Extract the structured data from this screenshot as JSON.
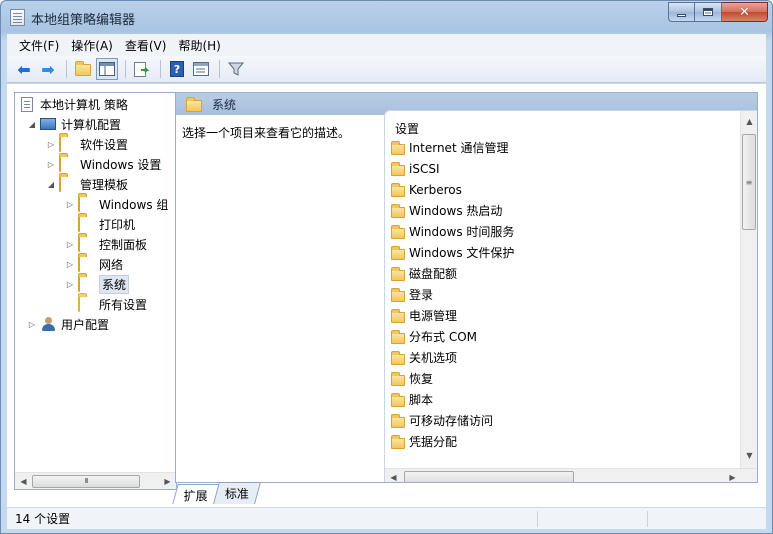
{
  "window": {
    "title": "本地组策略编辑器"
  },
  "menu": [
    "文件(F)",
    "操作(A)",
    "查看(V)",
    "帮助(H)"
  ],
  "tree": {
    "root": "本地计算机 策略",
    "computer_config": "计算机配置",
    "software_settings": "软件设置",
    "windows_settings": "Windows 设置",
    "admin_templates": "管理模板",
    "windows_components": "Windows 组",
    "printers": "打印机",
    "control_panel": "控制面板",
    "network": "网络",
    "system": "系统",
    "all_settings": "所有设置",
    "user_config": "用户配置"
  },
  "right_pane": {
    "header_title": "系统",
    "description": "选择一个项目来查看它的描述。",
    "column_header": "设置",
    "items": [
      "Internet 通信管理",
      "iSCSI",
      "Kerberos",
      "Windows 热启动",
      "Windows 时间服务",
      "Windows 文件保护",
      "磁盘配额",
      "登录",
      "电源管理",
      "分布式 COM",
      "关机选项",
      "恢复",
      "脚本",
      "可移动存储访问",
      "凭据分配"
    ]
  },
  "tabs": {
    "extended": "扩展",
    "standard": "标准"
  },
  "status": {
    "text": "14 个设置"
  },
  "scroll": {
    "thumb_grip": "III",
    "vthumb_grip": "≡"
  },
  "icons": {
    "back": "arrow-left-icon",
    "forward": "arrow-right-icon",
    "up": "folder-up-icon",
    "show_tree": "console-tree-icon",
    "export": "export-list-icon",
    "help": "help-icon",
    "properties": "properties-icon",
    "filter": "filter-icon"
  }
}
